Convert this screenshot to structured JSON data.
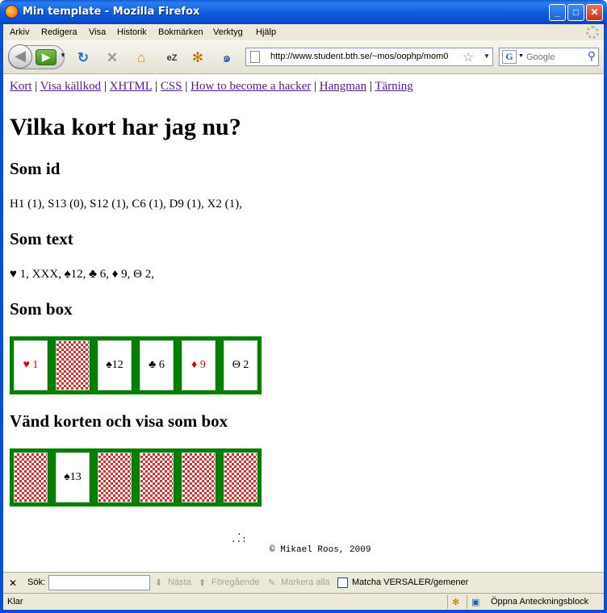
{
  "window": {
    "title": "Min template - Mozilla Firefox",
    "minimize_glyph": "_",
    "maximize_glyph": "□",
    "close_glyph": "✕"
  },
  "menubar": {
    "items": [
      "Arkiv",
      "Redigera",
      "Visa",
      "Historik",
      "Bokmärken",
      "Verktyg",
      "Hjälp"
    ]
  },
  "toolbar": {
    "back_icon": "◀",
    "forward_icon": "▶",
    "url": "http://www.student.bth.se/~mos/oophp/mom0",
    "search_engine": "G",
    "search_placeholder": "Google"
  },
  "page": {
    "nav_links": [
      "Kort",
      "Visa källkod",
      "XHTML",
      "CSS",
      "How to become a hacker",
      "Hangman",
      "Tärning"
    ],
    "heading": "Vilka kort har jag nu?",
    "section_id_heading": "Som id",
    "section_id_text": "H1 (1), S13 (0), S12 (1), C6 (1), D9 (1), X2 (1),",
    "section_text_heading": "Som text",
    "section_text_text": "♥ 1, XXX, ♠12, ♣ 6, ♦ 9, Θ 2,",
    "section_box_heading": "Som box",
    "box_cards": [
      {
        "label": "♥ 1",
        "face_up": true,
        "red": true
      },
      {
        "label": "",
        "face_up": false,
        "red": false
      },
      {
        "label": "♠12",
        "face_up": true,
        "red": false
      },
      {
        "label": "♣ 6",
        "face_up": true,
        "red": false
      },
      {
        "label": "♦ 9",
        "face_up": true,
        "red": true
      },
      {
        "label": "Θ 2",
        "face_up": true,
        "red": false
      }
    ],
    "section_flip_heading": "Vänd korten och visa som box",
    "flip_cards": [
      {
        "label": "",
        "face_up": false,
        "red": false
      },
      {
        "label": "♠13",
        "face_up": true,
        "red": false
      },
      {
        "label": "",
        "face_up": false,
        "red": false
      },
      {
        "label": "",
        "face_up": false,
        "red": false
      },
      {
        "label": "",
        "face_up": false,
        "red": false
      },
      {
        "label": "",
        "face_up": false,
        "red": false
      }
    ],
    "footer_dots_top": ".",
    "footer_dots_bottom": "..:",
    "footer": "© Mikael Roos, 2009"
  },
  "findbar": {
    "close": "✕",
    "label": "Sök:",
    "next": "Nästa",
    "previous": "Föregående",
    "highlight": "Markera alla",
    "match_case": "Matcha VERSALER/gemener"
  },
  "statusbar": {
    "status": "Klar",
    "notepad": "Öppna Anteckningsblock"
  },
  "colors": {
    "card_table": "#007f00",
    "red_suit": "#e00000",
    "link_visited": "#551a8b"
  }
}
